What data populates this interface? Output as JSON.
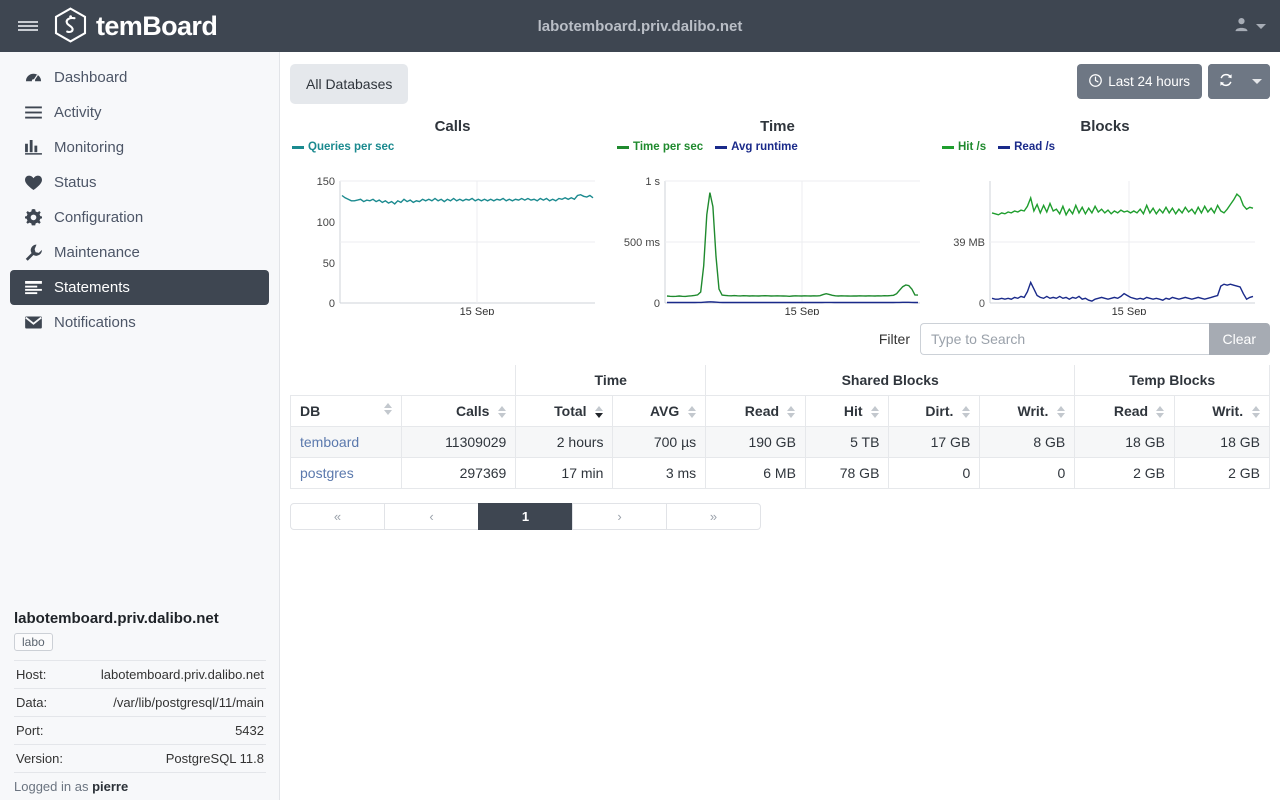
{
  "navbar": {
    "brand": "temBoard",
    "title": "labotemboard.priv.dalibo.net",
    "menu_icon": "hamburger-icon",
    "user_icon": "user-icon"
  },
  "sidebar": {
    "items": [
      {
        "label": "Dashboard",
        "icon": "dashboard-icon",
        "active": false
      },
      {
        "label": "Activity",
        "icon": "list-icon",
        "active": false
      },
      {
        "label": "Monitoring",
        "icon": "bar-chart-icon",
        "active": false
      },
      {
        "label": "Status",
        "icon": "heart-icon",
        "active": false
      },
      {
        "label": "Configuration",
        "icon": "gear-icon",
        "active": false
      },
      {
        "label": "Maintenance",
        "icon": "wrench-icon",
        "active": false
      },
      {
        "label": "Statements",
        "icon": "statements-icon",
        "active": true
      },
      {
        "label": "Notifications",
        "icon": "envelope-icon",
        "active": false
      }
    ],
    "instance": {
      "title": "labotemboard.priv.dalibo.net",
      "tag": "labo",
      "rows": [
        {
          "label": "Host:",
          "value": "labotemboard.priv.dalibo.net"
        },
        {
          "label": "Data:",
          "value": "/var/lib/postgresql/11/main"
        },
        {
          "label": "Port:",
          "value": "5432"
        },
        {
          "label": "Version:",
          "value": "PostgreSQL 11.8"
        }
      ],
      "logged_in_prefix": "Logged in as ",
      "logged_in_user": "pierre"
    }
  },
  "toolbar": {
    "all_databases_label": "All Databases",
    "time_range_label": "Last 24 hours",
    "clock_icon": "clock-icon",
    "refresh_icon": "refresh-icon",
    "caret_icon": "chevron-down-icon"
  },
  "filter": {
    "label": "Filter",
    "placeholder": "Type to Search",
    "value": "",
    "clear_label": "Clear"
  },
  "chart_data": [
    {
      "type": "line",
      "title": "Calls",
      "xlabel": "",
      "ylabel": "",
      "ylim": [
        0,
        160
      ],
      "yticks": [
        "0",
        "50",
        "100",
        "150"
      ],
      "xticks": [
        "15 Sep"
      ],
      "grid": true,
      "legend_position": "top-left",
      "series": [
        {
          "name": "Queries per sec",
          "color": "#1b8a8f",
          "values": [
            141,
            138,
            136,
            134,
            134,
            135,
            136,
            133,
            135,
            134,
            136,
            133,
            135,
            132,
            134,
            131,
            133,
            130,
            134,
            132,
            136,
            133,
            135,
            132,
            134,
            133,
            136,
            134,
            136,
            134,
            137,
            134,
            136,
            133,
            136,
            134,
            137,
            134,
            136,
            134,
            136,
            135,
            137,
            134,
            136,
            134,
            136,
            134,
            136,
            134,
            136,
            135,
            137,
            134,
            136,
            134,
            136,
            135,
            137,
            135,
            137,
            135,
            136,
            134,
            137,
            135,
            137,
            134,
            136,
            134,
            137,
            136,
            138,
            136,
            138,
            136,
            141,
            142,
            140,
            139,
            141,
            138
          ]
        }
      ]
    },
    {
      "type": "line",
      "title": "Time",
      "xlabel": "",
      "ylabel": "",
      "ylim": [
        0,
        1050
      ],
      "yticks": [
        "0",
        "500 ms",
        "1 s"
      ],
      "xticks": [
        "15 Sep"
      ],
      "grid": true,
      "legend_position": "top-left",
      "series": [
        {
          "name": "Time per sec",
          "color": "#1f8a2e",
          "values": [
            60,
            58,
            57,
            58,
            60,
            58,
            57,
            59,
            62,
            65,
            70,
            95,
            320,
            760,
            950,
            830,
            400,
            120,
            68,
            65,
            63,
            62,
            64,
            62,
            61,
            63,
            62,
            60,
            62,
            61,
            60,
            62,
            63,
            62,
            60,
            61,
            62,
            61,
            60,
            59,
            58,
            60,
            62,
            61,
            60,
            62,
            61,
            60,
            62,
            61,
            63,
            72,
            80,
            74,
            66,
            62,
            60,
            62,
            61,
            60,
            59,
            61,
            60,
            62,
            61,
            60,
            62,
            61,
            60,
            62,
            61,
            63,
            62,
            64,
            66,
            80,
            110,
            140,
            155,
            150,
            120,
            70,
            68
          ]
        },
        {
          "name": "Avg runtime",
          "color": "#1a2a8a",
          "values": [
            4,
            4,
            4,
            4,
            4,
            4,
            4,
            4,
            4,
            4,
            5,
            5,
            7,
            9,
            10,
            9,
            7,
            5,
            4,
            4,
            4,
            4,
            4,
            4,
            4,
            4,
            4,
            4,
            4,
            4,
            4,
            4,
            4,
            4,
            4,
            4,
            4,
            4,
            4,
            4,
            4,
            4,
            4,
            4,
            4,
            4,
            4,
            4,
            4,
            4,
            4,
            5,
            5,
            5,
            4,
            4,
            4,
            4,
            4,
            4,
            4,
            4,
            4,
            4,
            4,
            4,
            4,
            4,
            4,
            4,
            4,
            4,
            4,
            4,
            5,
            5,
            6,
            6,
            6,
            5,
            4,
            4
          ]
        }
      ]
    },
    {
      "type": "line",
      "title": "Blocks",
      "xlabel": "",
      "ylabel": "",
      "ylim": [
        0,
        130
      ],
      "yticks": [
        "0",
        "39 MB"
      ],
      "xticks": [
        "15 Sep"
      ],
      "grid": true,
      "legend_position": "top-left",
      "series": [
        {
          "name": "Hit /s",
          "color": "#1f9e2e",
          "values": [
            96,
            95,
            94,
            96,
            95,
            97,
            96,
            98,
            97,
            99,
            98,
            103,
            112,
            98,
            105,
            96,
            104,
            97,
            106,
            98,
            100,
            95,
            103,
            94,
            100,
            95,
            104,
            96,
            102,
            95,
            101,
            96,
            103,
            97,
            100,
            96,
            99,
            95,
            98,
            96,
            99,
            97,
            98,
            96,
            98,
            96,
            100,
            95,
            104,
            96,
            101,
            95,
            100,
            96,
            102,
            96,
            101,
            95,
            100,
            96,
            102,
            97,
            100,
            95,
            102,
            96,
            103,
            97,
            101,
            96,
            104,
            98,
            96,
            100,
            105,
            110,
            116,
            113,
            104,
            100,
            102,
            101
          ]
        },
        {
          "name": "Read /s",
          "color": "#1a2a8a",
          "values": [
            5,
            4,
            4,
            5,
            4,
            5,
            4,
            6,
            5,
            7,
            6,
            12,
            22,
            15,
            8,
            6,
            5,
            7,
            5,
            6,
            5,
            7,
            5,
            6,
            4,
            6,
            5,
            7,
            4,
            5,
            3,
            2,
            4,
            5,
            6,
            5,
            4,
            5,
            6,
            5,
            7,
            10,
            8,
            6,
            5,
            4,
            5,
            4,
            6,
            5,
            4,
            5,
            4,
            3,
            5,
            4,
            6,
            5,
            4,
            5,
            6,
            5,
            4,
            5,
            6,
            5,
            4,
            5,
            6,
            7,
            8,
            18,
            20,
            19,
            20,
            19,
            18,
            17,
            10,
            4,
            6,
            7
          ]
        }
      ]
    }
  ],
  "table": {
    "group_headers": [
      {
        "label": "",
        "span": 2
      },
      {
        "label": "Time",
        "span": 2
      },
      {
        "label": "Shared Blocks",
        "span": 4
      },
      {
        "label": "Temp Blocks",
        "span": 2
      }
    ],
    "columns": [
      {
        "label": "DB",
        "align": "left",
        "sort": "none"
      },
      {
        "label": "Calls",
        "align": "right",
        "sort": "none"
      },
      {
        "label": "Total",
        "align": "right",
        "sort": "desc"
      },
      {
        "label": "AVG",
        "align": "right",
        "sort": "none"
      },
      {
        "label": "Read",
        "align": "right",
        "sort": "none"
      },
      {
        "label": "Hit",
        "align": "right",
        "sort": "none"
      },
      {
        "label": "Dirt.",
        "align": "right",
        "sort": "none"
      },
      {
        "label": "Writ.",
        "align": "right",
        "sort": "none"
      },
      {
        "label": "Read",
        "align": "right",
        "sort": "none"
      },
      {
        "label": "Writ.",
        "align": "right",
        "sort": "none"
      }
    ],
    "rows": [
      {
        "db": "temboard",
        "calls": "11309029",
        "total": "2 hours",
        "avg": "700 µs",
        "shared_read": "190 GB",
        "shared_hit": "5 TB",
        "shared_dirt": "17 GB",
        "shared_writ": "8 GB",
        "temp_read": "18 GB",
        "temp_writ": "18 GB"
      },
      {
        "db": "postgres",
        "calls": "297369",
        "total": "17 min",
        "avg": "3 ms",
        "shared_read": "6 MB",
        "shared_hit": "78 GB",
        "shared_dirt": "0",
        "shared_writ": "0",
        "temp_read": "2 GB",
        "temp_writ": "2 GB"
      }
    ]
  },
  "pagination": {
    "buttons": [
      {
        "label": "«",
        "active": false
      },
      {
        "label": "‹",
        "active": false
      },
      {
        "label": "1",
        "active": true
      },
      {
        "label": "›",
        "active": false
      },
      {
        "label": "»",
        "active": false
      }
    ]
  },
  "colors": {
    "navbar_bg": "#3e4651",
    "sidebar_bg": "#f7f8fa",
    "accent_teal": "#1b8a8f",
    "accent_green": "#1f8a2e",
    "accent_blue": "#1a2a8a",
    "link": "#5b79ad",
    "grey_button": "#6e7784"
  }
}
